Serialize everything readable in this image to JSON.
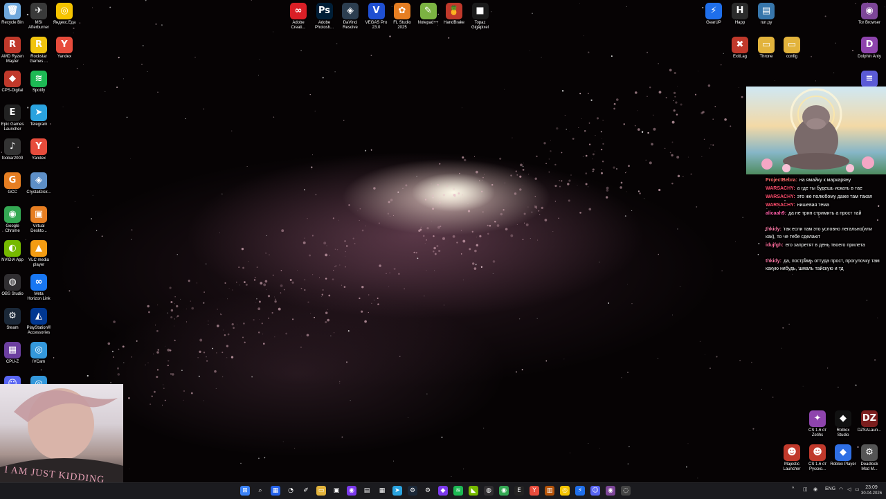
{
  "desktop": {
    "left_icons": [
      {
        "label": "Recycle Bin",
        "icon": "recycle-bin-icon",
        "color": "#6fa8dc",
        "glyph": "🗑"
      },
      {
        "label": "MSI\nAfterburner",
        "icon": "msi-afterburner-icon",
        "color": "#3a3a3a",
        "glyph": "✈"
      },
      {
        "label": "Яндекс.Еда",
        "icon": "yandex-eda-icon",
        "color": "#f5c400",
        "glyph": "◎"
      },
      {
        "label": "AMD Ryzen\nMaster",
        "icon": "amd-ryzen-master-icon",
        "color": "#c0392b",
        "glyph": "R"
      },
      {
        "label": "Rockstar\nGames ...",
        "icon": "rockstar-games-icon",
        "color": "#f1c40f",
        "glyph": "R"
      },
      {
        "label": "Yandex",
        "icon": "yandex-browser-icon",
        "color": "#e74c3c",
        "glyph": "Y"
      },
      {
        "label": "CPS-Digital",
        "icon": "cps-digital-icon",
        "color": "#c0392b",
        "glyph": "◆"
      },
      {
        "label": "Spotify",
        "icon": "spotify-icon",
        "color": "#1db954",
        "glyph": "≋"
      },
      {
        "label": "Epic Games\nLauncher",
        "icon": "epic-games-icon",
        "color": "#222222",
        "glyph": "E"
      },
      {
        "label": "Telegram",
        "icon": "telegram-icon",
        "color": "#2aa3df",
        "glyph": "➤"
      },
      {
        "label": "foobar2000",
        "icon": "foobar2000-icon",
        "color": "#333333",
        "glyph": "♪"
      },
      {
        "label": "Yandex",
        "icon": "yandex-icon",
        "color": "#e74c3c",
        "glyph": "Y"
      },
      {
        "label": "GCC",
        "icon": "gcc-icon",
        "color": "#e67e22",
        "glyph": "G"
      },
      {
        "label": "CrystalDisk...",
        "icon": "crystaldisk-icon",
        "color": "#5d8fc7",
        "glyph": "◈"
      },
      {
        "label": "Google\nChrome",
        "icon": "chrome-icon",
        "color": "#34a853",
        "glyph": "◉"
      },
      {
        "label": "Virtual\nDeskto...",
        "icon": "virtual-desktop-icon",
        "color": "#e67e22",
        "glyph": "▣"
      },
      {
        "label": "NVIDIA App",
        "icon": "nvidia-icon",
        "color": "#76b900",
        "glyph": "◐"
      },
      {
        "label": "VLC media\nplayer",
        "icon": "vlc-icon",
        "color": "#f39c12",
        "glyph": "▲"
      },
      {
        "label": "OBS Studio",
        "icon": "obs-icon",
        "color": "#302e31",
        "glyph": "◍"
      },
      {
        "label": "Meta\nHorizon Link",
        "icon": "meta-horizon-icon",
        "color": "#1877f2",
        "glyph": "∞"
      },
      {
        "label": "Steam",
        "icon": "steam-icon",
        "color": "#1b2838",
        "glyph": "⚙"
      },
      {
        "label": "PlayStation®\nAccessories",
        "icon": "playstation-icon",
        "color": "#003791",
        "glyph": "◭"
      },
      {
        "label": "CPU-Z",
        "icon": "cpu-z-icon",
        "color": "#6c3fa0",
        "glyph": "▦"
      },
      {
        "label": "IVCam",
        "icon": "ivcam-icon",
        "color": "#3498db",
        "glyph": "◎"
      },
      {
        "label": "",
        "icon": "discord-icon",
        "color": "#5865f2",
        "glyph": "☺"
      },
      {
        "label": "",
        "icon": "app-icon",
        "color": "#3498db",
        "glyph": "◎"
      }
    ],
    "top_icons": [
      {
        "label": "Adobe\nCreati...",
        "icon": "adobe-creative-cloud-icon",
        "color": "#da1f26",
        "glyph": "∞"
      },
      {
        "label": "Adobe\nPhotosh...",
        "icon": "photoshop-icon",
        "color": "#001e36",
        "glyph": "Ps"
      },
      {
        "label": "DaVinci\nResolve",
        "icon": "davinci-resolve-icon",
        "color": "#2c3e50",
        "glyph": "◈"
      },
      {
        "label": "VEGAS Pro\n23.0",
        "icon": "vegas-pro-icon",
        "color": "#1f4fd1",
        "glyph": "V"
      },
      {
        "label": "FL Studio\n2025",
        "icon": "fl-studio-icon",
        "color": "#e67e22",
        "glyph": "✿"
      },
      {
        "label": "Notepad++",
        "icon": "notepad-plus-plus-icon",
        "color": "#7cb342",
        "glyph": "✎"
      },
      {
        "label": "HandBrake",
        "icon": "handbrake-icon",
        "color": "#c0392b",
        "glyph": "🍍"
      },
      {
        "label": "Topaz\nGigapixel",
        "icon": "topaz-gigapixel-icon",
        "color": "#1a1a1a",
        "glyph": "■"
      }
    ],
    "right_icons": [
      {
        "label": "GearUP",
        "icon": "gearup-icon",
        "color": "#1f6feb",
        "glyph": "⚡"
      },
      {
        "label": "Happ",
        "icon": "happ-icon",
        "color": "#2b2b2b",
        "glyph": "H"
      },
      {
        "label": "run.py",
        "icon": "python-file-icon",
        "color": "#3776ab",
        "glyph": "▤"
      },
      {
        "label": "Tor Browser",
        "icon": "tor-browser-icon",
        "color": "#7d4698",
        "glyph": "◉"
      },
      {
        "label": "ExitLag",
        "icon": "exitlag-icon",
        "color": "#c0392b",
        "glyph": "✖"
      },
      {
        "label": "Throne",
        "icon": "throne-folder-icon",
        "color": "#e2b33c",
        "glyph": "▭"
      },
      {
        "label": "config",
        "icon": "config-folder-icon",
        "color": "#e2b33c",
        "glyph": "▭"
      },
      {
        "label": "Dolphin Anty",
        "icon": "dolphin-anty-icon",
        "color": "#8e44ad",
        "glyph": "D"
      },
      {
        "label": "",
        "icon": "menu-app-icon",
        "color": "#5b5bd6",
        "glyph": "≡"
      }
    ],
    "bottom_right_icons": [
      {
        "label": "CS 1.6 от\nZetihs",
        "icon": "cs16-icon",
        "color": "#8e44ad",
        "glyph": "✦"
      },
      {
        "label": "Roblox\nStudio",
        "icon": "roblox-studio-icon",
        "color": "#111111",
        "glyph": "◆"
      },
      {
        "label": "DZSALaun...",
        "icon": "dzsa-launcher-icon",
        "color": "#7b1e1e",
        "glyph": "DZ"
      },
      {
        "label": "Majestic\nLauncher",
        "icon": "majestic-launcher-icon",
        "color": "#c0392b",
        "glyph": "☻"
      },
      {
        "label": "CS 1.6 от\nРусско...",
        "icon": "cs16-russian-icon",
        "color": "#c0392b",
        "glyph": "☻"
      },
      {
        "label": "Roblox Player",
        "icon": "roblox-player-icon",
        "color": "#2f6fe4",
        "glyph": "◆"
      },
      {
        "label": "Deadlock\nMod M...",
        "icon": "deadlock-mod-icon",
        "color": "#555555",
        "glyph": "⚙"
      }
    ]
  },
  "chat": {
    "messages": [
      {
        "user": "ProjectBebra:",
        "text": "на ямайку к маркаряну",
        "color": "#ff6b6b"
      },
      {
        "user": "WARSACHY:",
        "text": "а где ты будешь искать в тае",
        "color": "#ff4d6d"
      },
      {
        "user": "WARSACHY:",
        "text": "это же полюбому даже там такая",
        "color": "#ff4d6d"
      },
      {
        "user": "WARSACHY:",
        "text": "нишевая тема",
        "color": "#ff4d6d"
      },
      {
        "user": "alicaah9:",
        "text": "да не трип стримить а прост тай",
        "color": "#ff5ea8"
      },
      {
        "user": "thkidy:",
        "text": "так если там это условно легально(или как), то че тебе сделают",
        "color": "#ff7aa8"
      },
      {
        "user": "idujfgh:",
        "text": "его запретят в день твоего прилета",
        "color": "#ff6b9b"
      },
      {
        "user": "thkidy:",
        "text": "да, постримь оттуда прост, прогулочку там какую нибудь, шмаль тайскую и тд",
        "color": "#ff7aa8"
      }
    ]
  },
  "webcam": {
    "shirt_text": "I AM JUST KIDDING"
  },
  "taskbar": {
    "apps": [
      {
        "icon": "start-icon",
        "color": "#3b82f6",
        "glyph": "⊞"
      },
      {
        "icon": "search-icon",
        "color": "#1b1b1f",
        "glyph": "⌕"
      },
      {
        "icon": "widgets-icon",
        "color": "#2563eb",
        "glyph": "▦"
      },
      {
        "icon": "copilot-icon",
        "color": "#1b1b1f",
        "glyph": "◔"
      },
      {
        "icon": "vscode-icon",
        "color": "#1b1b1f",
        "glyph": "✐"
      },
      {
        "icon": "file-explorer-icon",
        "color": "#e2b33c",
        "glyph": "▭"
      },
      {
        "icon": "app-window-icon",
        "color": "#1b1b1f",
        "glyph": "▣"
      },
      {
        "icon": "media-icon",
        "color": "#7c3aed",
        "glyph": "◉"
      },
      {
        "icon": "notes-icon",
        "color": "#1b1b1f",
        "glyph": "▤"
      },
      {
        "icon": "store-icon",
        "color": "#1b1b1f",
        "glyph": "▦"
      },
      {
        "icon": "telegram-taskbar-icon",
        "color": "#2aa3df",
        "glyph": "➤"
      },
      {
        "icon": "steam-taskbar-icon",
        "color": "#1b2838",
        "glyph": "⚙"
      },
      {
        "icon": "settings-icon",
        "color": "#1b1b1f",
        "glyph": "⚙"
      },
      {
        "icon": "obsidian-icon",
        "color": "#7c3aed",
        "glyph": "◆"
      },
      {
        "icon": "spotify-taskbar-icon",
        "color": "#1db954",
        "glyph": "≋"
      },
      {
        "icon": "nvidia-taskbar-icon",
        "color": "#76b900",
        "glyph": "◣"
      },
      {
        "icon": "obs-taskbar-icon",
        "color": "#302e31",
        "glyph": "◍"
      },
      {
        "icon": "chrome-taskbar-icon",
        "color": "#34a853",
        "glyph": "◉"
      },
      {
        "icon": "epic-taskbar-icon",
        "color": "#222222",
        "glyph": "E"
      },
      {
        "icon": "yandex-taskbar-icon",
        "color": "#e74c3c",
        "glyph": "Y"
      },
      {
        "icon": "winrar-icon",
        "color": "#b45309",
        "glyph": "▥"
      },
      {
        "icon": "yandex-eda-taskbar-icon",
        "color": "#f5c400",
        "glyph": "◎"
      },
      {
        "icon": "gearup-taskbar-icon",
        "color": "#1f6feb",
        "glyph": "⚡"
      },
      {
        "icon": "discord-taskbar-icon",
        "color": "#5865f2",
        "glyph": "☺"
      },
      {
        "icon": "tor-taskbar-icon",
        "color": "#7d4698",
        "glyph": "◉"
      },
      {
        "icon": "app-taskbar-icon",
        "color": "#444444",
        "glyph": "◌"
      }
    ],
    "tray": {
      "lang": "ENG",
      "time": "23:09",
      "date": "30.04.2026"
    }
  }
}
